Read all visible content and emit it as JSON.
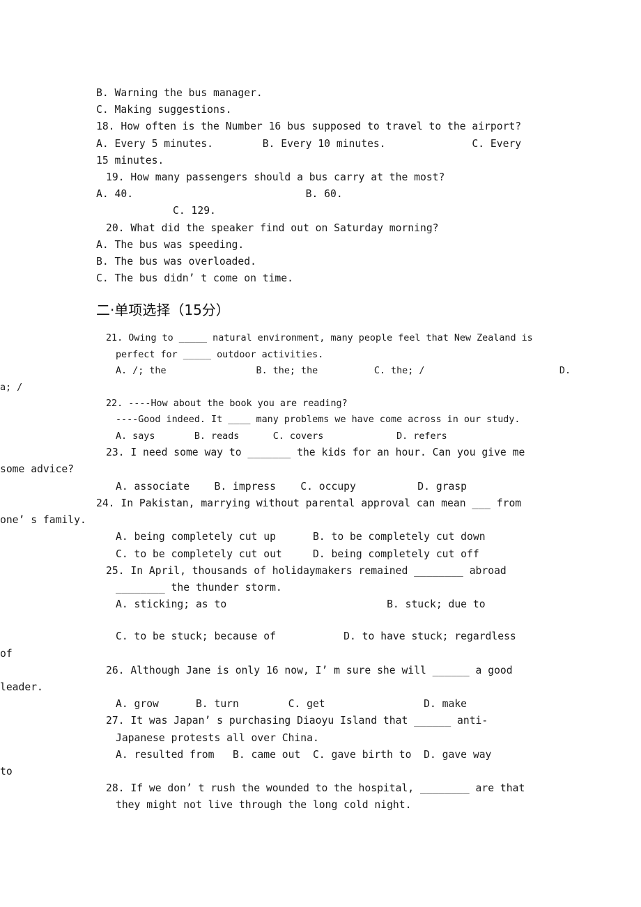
{
  "document": {
    "type": "english-exam-paper",
    "language_note": "English exam with Chinese section heading"
  },
  "listening_tail": {
    "q17_options": [
      "B. Warning the bus manager.",
      "C. Making suggestions."
    ],
    "q18": {
      "stem": "18. How often is the Number 16 bus supposed to travel to the airport?",
      "line1": "A. Every 5 minutes.        B. Every 10 minutes.              C. Every",
      "line2": "15 minutes."
    },
    "q19": {
      "stem": "19. How many passengers should a bus carry at the most?",
      "line1": "A. 40.                            B. 60.",
      "line2": "C. 129."
    },
    "q20": {
      "stem": "20. What did the speaker find out on Saturday morning?",
      "options": [
        "A. The bus was speeding.",
        "B. The bus was overloaded.",
        "C. The bus didn’ t come on time."
      ]
    }
  },
  "section_two": {
    "heading": "二·单项选择（15分）",
    "questions": [
      {
        "number": "21",
        "size": "small",
        "lines": [
          "21. Owing to _____ natural environment, many people feel that New Zealand is",
          "perfect for _____ outdoor activities."
        ],
        "option_lines": [
          "A. /; the                B. the; the          C. the; /                        D.",
          "a; /"
        ]
      },
      {
        "number": "22",
        "size": "small",
        "lines": [
          "22. ----How about the book you are reading?",
          "----Good indeed. It ____ many problems we have come across in our study."
        ],
        "option_lines": [
          "A. says       B. reads      C. covers             D. refers"
        ]
      },
      {
        "number": "23",
        "size": "normal",
        "lines": [
          "23. I need some way to _______ the kids for an hour. Can you give me",
          "some advice?"
        ],
        "option_lines": [
          "A. associate    B. impress    C. occupy          D. grasp"
        ]
      },
      {
        "number": "24",
        "size": "normal",
        "lines": [
          "24. In Pakistan, marrying without parental approval can mean ___ from",
          "one’ s family."
        ],
        "option_lines": [
          "A. being completely cut up      B. to be completely cut down",
          "C. to be completely cut out     D. being completely cut off"
        ]
      },
      {
        "number": "25",
        "size": "normal",
        "lines": [
          "25. In April, thousands of holidaymakers remained ________ abroad",
          "________ the thunder storm."
        ],
        "option_lines": [
          "A. sticking; as to                          B. stuck; due to",
          "C. to be stuck; because of           D. to have stuck; regardless",
          "of"
        ]
      },
      {
        "number": "26",
        "size": "normal",
        "lines": [
          "26. Although Jane is only 16 now, I’ m sure she will ______ a good",
          "leader."
        ],
        "option_lines": [
          "A. grow      B. turn        C. get                D. make"
        ]
      },
      {
        "number": "27",
        "size": "normal",
        "lines": [
          "27. It was Japan’ s purchasing Diaoyu Island that ______ anti-",
          "Japanese protests all over China."
        ],
        "option_lines": [
          "A. resulted from   B. came out  C. gave birth to  D. gave way",
          "to"
        ]
      },
      {
        "number": "28",
        "size": "normal",
        "lines": [
          "28. If we don’ t rush the wounded to the hospital, ________ are that",
          "they might not live through the long cold night."
        ],
        "option_lines": []
      }
    ]
  }
}
